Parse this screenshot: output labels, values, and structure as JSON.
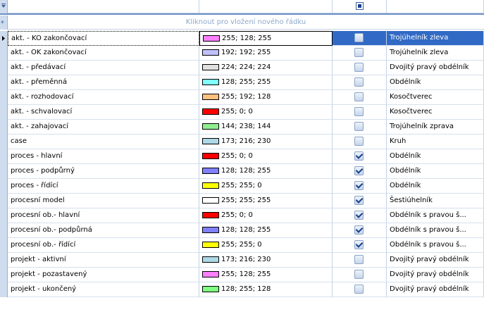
{
  "new_row_text": "Kliknout pro vložení nového řádku",
  "rows": [
    {
      "name": "akt. - KO zakončovací",
      "color_hex": "#ff80ff",
      "color_text": "255; 128; 255",
      "checked": false,
      "shape": "Trojúhelník zleva"
    },
    {
      "name": "akt. - OK zakončovací",
      "color_hex": "#c0c0ff",
      "color_text": "192; 192; 255",
      "checked": false,
      "shape": "Trojúhelník zleva"
    },
    {
      "name": "akt. - předávací",
      "color_hex": "#e0e0e0",
      "color_text": "224; 224; 224",
      "checked": false,
      "shape": "Dvojitý pravý obdélník"
    },
    {
      "name": "akt. - přeměnná",
      "color_hex": "#80ffff",
      "color_text": "128; 255; 255",
      "checked": false,
      "shape": "Obdélník"
    },
    {
      "name": "akt. - rozhodovací",
      "color_hex": "#ffc080",
      "color_text": "255; 192; 128",
      "checked": false,
      "shape": "Kosočtverec"
    },
    {
      "name": "akt. - schvalovací",
      "color_hex": "#ff0000",
      "color_text": "255; 0; 0",
      "checked": false,
      "shape": "Kosočtverec"
    },
    {
      "name": "akt. - zahajovací",
      "color_hex": "#90ee90",
      "color_text": "144; 238; 144",
      "checked": false,
      "shape": "Trojúhelník zprava"
    },
    {
      "name": "case",
      "color_hex": "#add8e6",
      "color_text": "173; 216; 230",
      "checked": false,
      "shape": "Kruh"
    },
    {
      "name": "proces - hlavní",
      "color_hex": "#ff0000",
      "color_text": "255; 0; 0",
      "checked": true,
      "shape": "Obdélník"
    },
    {
      "name": "proces - podpůrný",
      "color_hex": "#8080ff",
      "color_text": "128; 128; 255",
      "checked": true,
      "shape": "Obdélník"
    },
    {
      "name": "proces - řídící",
      "color_hex": "#ffff00",
      "color_text": "255; 255; 0",
      "checked": true,
      "shape": "Obdélník"
    },
    {
      "name": "procesní model",
      "color_hex": "#ffffff",
      "color_text": "255; 255; 255",
      "checked": true,
      "shape": "Šestiúhelník"
    },
    {
      "name": "procesní ob.- hlavní",
      "color_hex": "#ff0000",
      "color_text": "255; 0; 0",
      "checked": true,
      "shape": "Obdélník s pravou š..."
    },
    {
      "name": "procesní ob.- podpůrná",
      "color_hex": "#8080ff",
      "color_text": "128; 128; 255",
      "checked": true,
      "shape": "Obdélník s pravou š..."
    },
    {
      "name": "procesní ob.- řídící",
      "color_hex": "#ffff00",
      "color_text": "255; 255; 0",
      "checked": true,
      "shape": "Obdélník s pravou š..."
    },
    {
      "name": "projekt - aktivní",
      "color_hex": "#add8e6",
      "color_text": "173; 216; 230",
      "checked": false,
      "shape": "Dvojitý pravý obdélník"
    },
    {
      "name": "projekt - pozastavený",
      "color_hex": "#ff80ff",
      "color_text": "255; 128; 255",
      "checked": false,
      "shape": "Dvojitý pravý obdélník"
    },
    {
      "name": "projekt - ukončený",
      "color_hex": "#80ff80",
      "color_text": "128; 255; 128",
      "checked": false,
      "shape": "Dvojitý pravý obdélník"
    }
  ]
}
